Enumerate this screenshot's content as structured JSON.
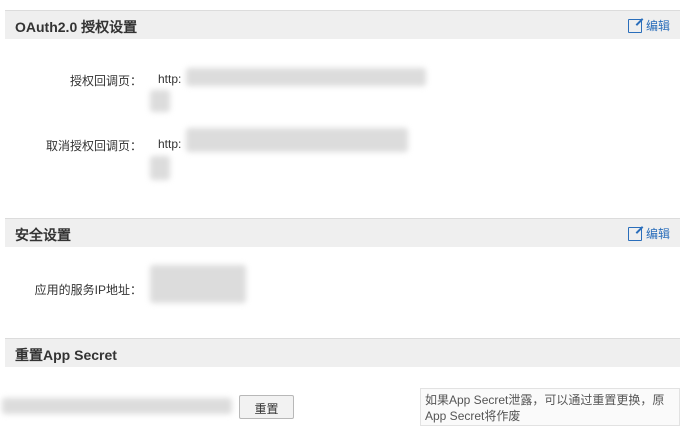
{
  "oauth": {
    "title": "OAuth2.0 授权设置",
    "edit_label": "编辑",
    "callback_label": "授权回调页：",
    "callback_value": "http:",
    "cancel_label": "取消授权回调页：",
    "cancel_value": "http:"
  },
  "security": {
    "title": "安全设置",
    "edit_label": "编辑",
    "ip_label": "应用的服务IP地址："
  },
  "reset": {
    "title": "重置App Secret",
    "button_label": "重置",
    "tip": "如果App Secret泄露，可以通过重置更换，原App Secret将作废"
  },
  "colors": {
    "header_bg": "#efefef",
    "link": "#2a6ebb"
  }
}
